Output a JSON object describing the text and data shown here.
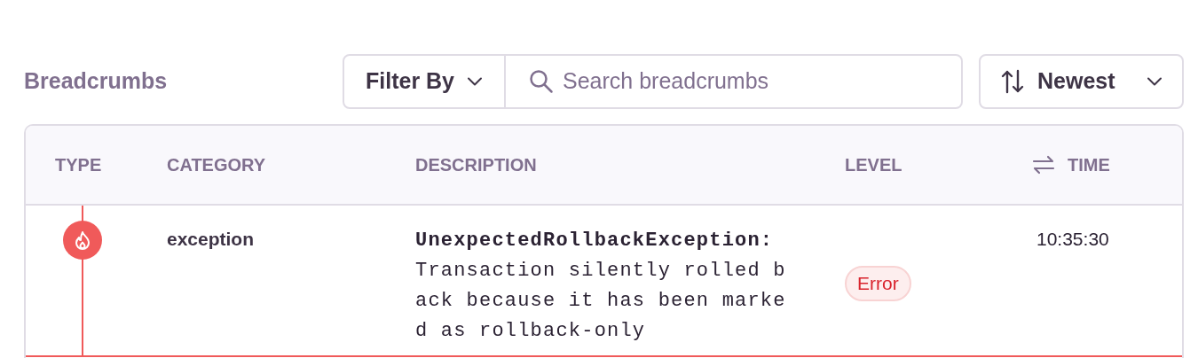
{
  "title": "Breadcrumbs",
  "filter": {
    "label": "Filter By"
  },
  "search": {
    "placeholder": "Search breadcrumbs"
  },
  "sort": {
    "label": "Newest"
  },
  "table": {
    "columns": [
      {
        "label": "TYPE"
      },
      {
        "label": "CATEGORY"
      },
      {
        "label": "DESCRIPTION"
      },
      {
        "label": "LEVEL"
      },
      {
        "label": "TIME",
        "kind": "time"
      }
    ],
    "rows": [
      {
        "kind": "error",
        "category": "exception",
        "description": "**UnexpectedRollbackException:** Transaction silently rolled back because it has been marked as rollback-only",
        "level": "Error",
        "time": "10:35:30"
      }
    ]
  }
}
